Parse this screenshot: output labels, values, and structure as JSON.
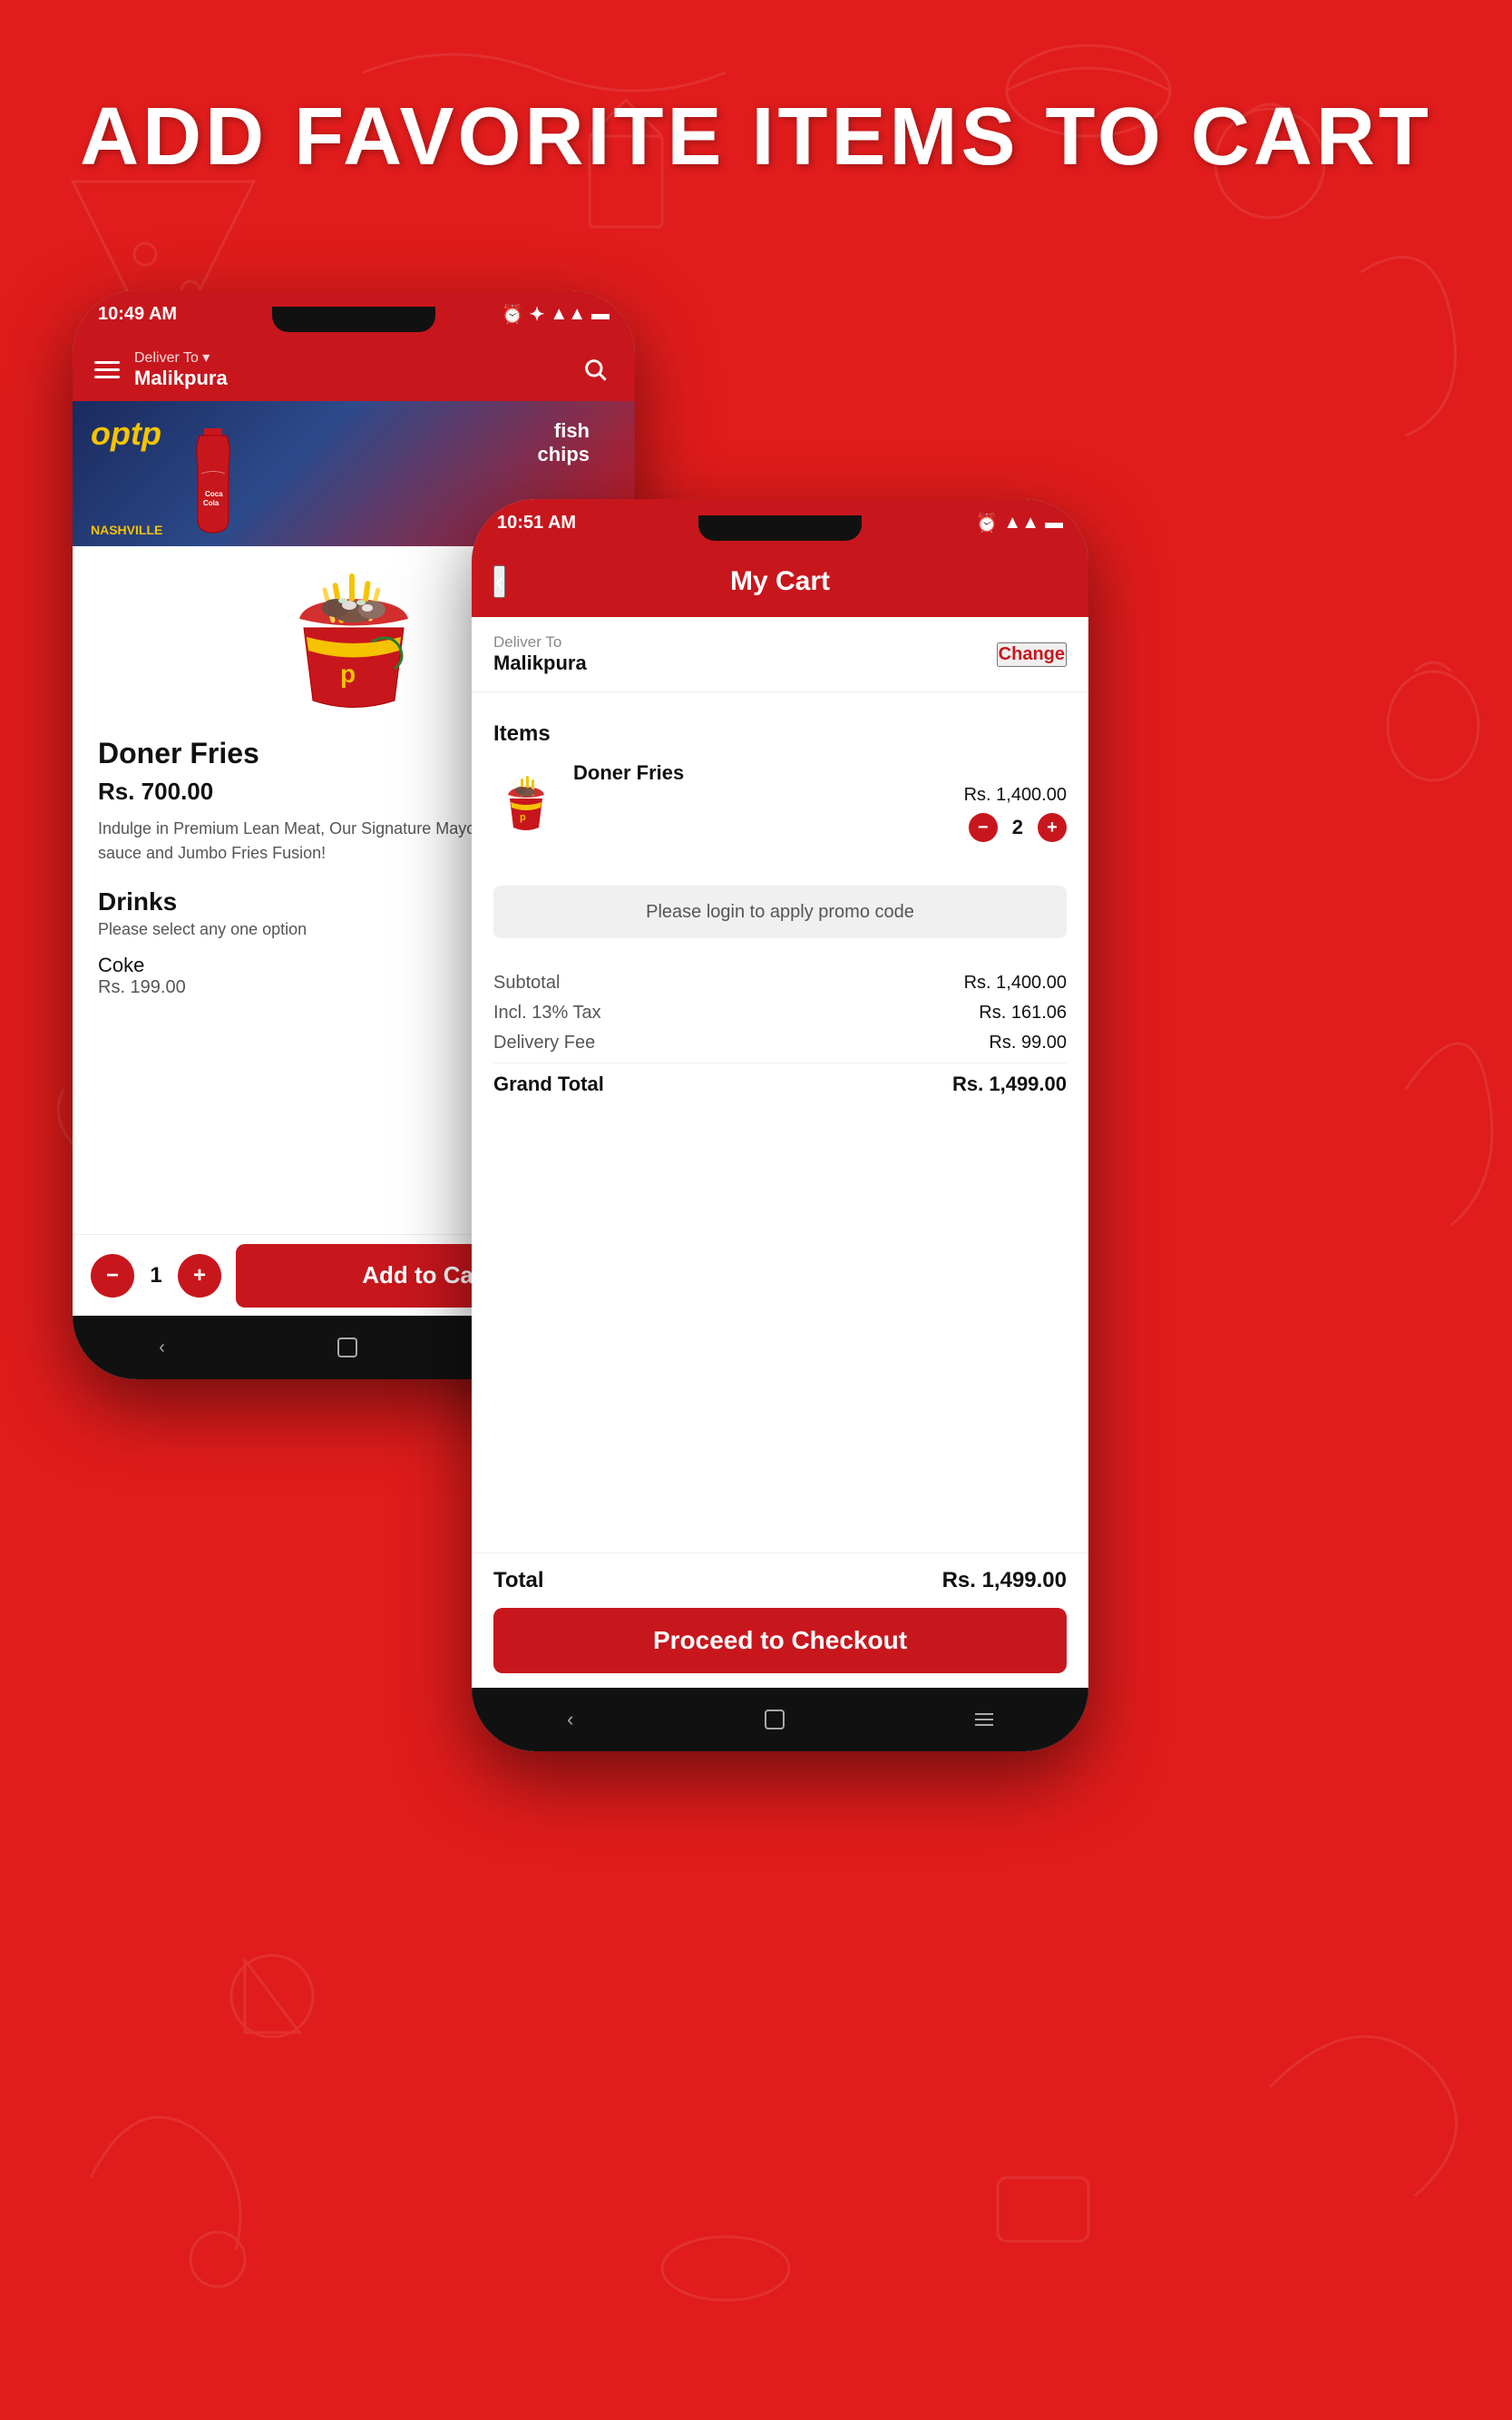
{
  "page": {
    "bg_color": "#e01c1c",
    "hero_title": "ADD FAVORITE ITEMS TO CART"
  },
  "phone_left": {
    "status_bar": {
      "time": "10:49 AM",
      "icons": "⏰ ✦ ▲ ▲ ▬"
    },
    "nav": {
      "deliver_label": "Deliver To ▾",
      "location": "Malikpura"
    },
    "product": {
      "name": "Doner Fries",
      "price": "Rs. 700.00",
      "description": "Indulge in Premium Lean Meat, Our Signature Mayo, Our special chilly sauce and Jumbo Fries Fusion!",
      "drinks_label": "Drinks",
      "drinks_subtitle": "Please select any one option",
      "drink1_name": "Coke",
      "drink1_price": "Rs. 199.00"
    },
    "bottom_action": {
      "qty": "1",
      "add_to_cart": "Add to Cart",
      "minus_label": "−",
      "plus_label": "+"
    }
  },
  "phone_right": {
    "status_bar": {
      "time": "10:51 AM",
      "icons": "⏰ ▲ ▲ ▬"
    },
    "header": {
      "back_label": "‹",
      "title": "My Cart"
    },
    "deliver": {
      "label": "Deliver To",
      "location": "Malikpura",
      "change_label": "Change"
    },
    "items_label": "Items",
    "cart_item": {
      "name": "Doner Fries",
      "price": "Rs. 1,400.00",
      "qty": "2",
      "minus_label": "−",
      "plus_label": "+"
    },
    "promo": {
      "label": "Please login to apply promo code"
    },
    "breakdown": {
      "subtotal_label": "Subtotal",
      "subtotal_value": "Rs. 1,400.00",
      "tax_label": "Incl. 13% Tax",
      "tax_value": "Rs. 161.06",
      "delivery_label": "Delivery Fee",
      "delivery_value": "Rs. 99.00",
      "grand_total_label": "Grand Total",
      "grand_total_value": "Rs. 1,499.00"
    },
    "bottom": {
      "total_label": "Total",
      "total_value": "Rs. 1,499.00",
      "checkout_label": "Proceed to Checkout"
    }
  }
}
